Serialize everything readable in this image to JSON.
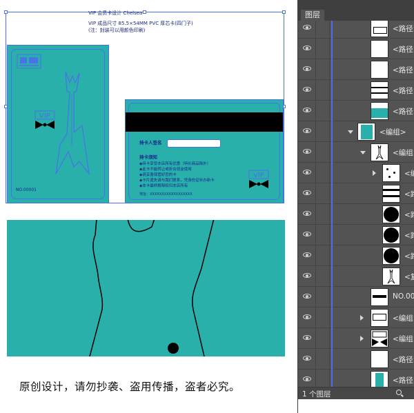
{
  "header_lines": [
    "VIP 会员卡设计 Chelsea",
    "VIP 成品尺寸 85.5×54MM PVC 厚芯卡(四门子)",
    "(注：封装可以用颜色印刷)"
  ],
  "front_card": {
    "number": "NO.00001",
    "badge_text": "VIP"
  },
  "back_card": {
    "holder_label": "持卡人签名",
    "notice_title": "持卡须知",
    "rules": [
      "◆持卡享受本店所有优惠（特价商品除外）",
      "◆此卡不能转让或折合现金使用",
      "◆请妥善保管好您的卡",
      "◆卡片遗失请与我们联系，凭身份证补办新卡",
      "◆本卡最终解释权归本店所有"
    ],
    "address": "地址：XXXXXXXXXXXXXXXXXX",
    "badge_text": "VIP"
  },
  "caption": "原创设计，请勿抄袭、盗用传播，盗者必究。",
  "layers_panel": {
    "tab_label": "图层",
    "footer_text": "1 个图层",
    "rows": [
      {
        "label": "<路径>",
        "thumb": "logo-top"
      },
      {
        "label": "<路径>",
        "thumb": "blank"
      },
      {
        "label": "<路径>",
        "thumb": "blank"
      },
      {
        "label": "<路径>",
        "thumb": "lines"
      },
      {
        "label": "<路径>",
        "thumb": "teal-bar"
      },
      {
        "label": "<编组>",
        "thumb": "teal-card"
      },
      {
        "label": "<编组>",
        "thumb": "guitar"
      },
      {
        "label": "<编",
        "thumb": "dots"
      },
      {
        "label": "<路",
        "thumb": "stripes"
      },
      {
        "label": "<路",
        "thumb": "circle"
      },
      {
        "label": "<路",
        "thumb": "circle"
      },
      {
        "label": "<路",
        "thumb": "circle"
      },
      {
        "label": "<复",
        "thumb": "guitar"
      },
      {
        "label": "NO.000",
        "thumb": "no-text"
      },
      {
        "label": "<编组>",
        "thumb": "logo"
      },
      {
        "label": "<编组>",
        "thumb": "vip"
      },
      {
        "label": "<路径>",
        "thumb": "blank"
      },
      {
        "label": "<路径>",
        "thumb": "teal-bar"
      }
    ]
  },
  "colors": {
    "card_teal": "#2ab0aa",
    "selection_blue": "#4a72e8",
    "panel_bg": "#535353"
  }
}
